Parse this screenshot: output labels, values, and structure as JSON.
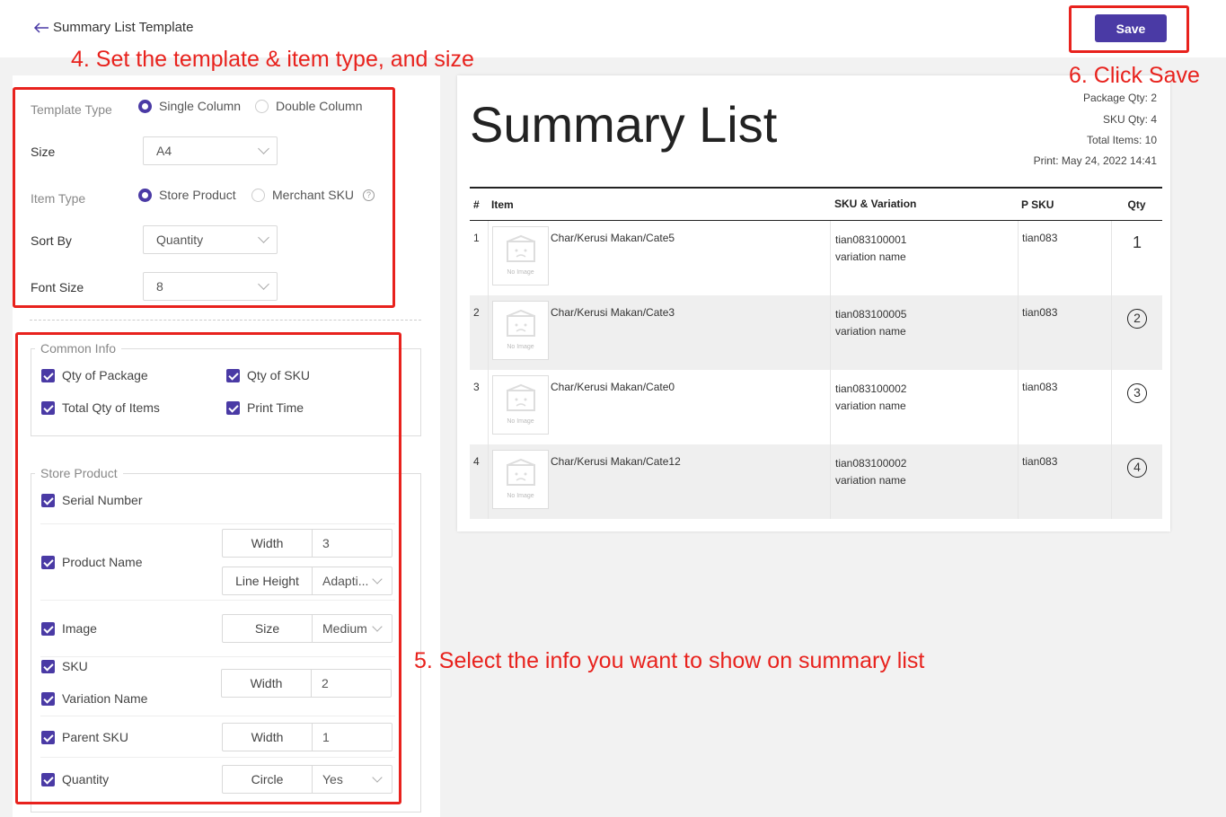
{
  "header": {
    "title": "Summary List Template",
    "save_label": "Save"
  },
  "settings": {
    "template_type_label": "Template Type",
    "template_options": [
      "Single Column",
      "Double Column"
    ],
    "size_label": "Size",
    "size_value": "A4",
    "item_type_label": "Item Type",
    "item_type_options": [
      "Store Product",
      "Merchant SKU"
    ],
    "sort_by_label": "Sort By",
    "sort_by_value": "Quantity",
    "font_size_label": "Font Size",
    "font_size_value": "8"
  },
  "common_info": {
    "legend": "Common Info",
    "items": [
      "Qty of Package",
      "Qty of SKU",
      "Total Qty of Items",
      "Print Time"
    ]
  },
  "store_product": {
    "legend": "Store Product",
    "serial_number": "Serial Number",
    "product_name": "Product Name",
    "product_name_width_label": "Width",
    "product_name_width_value": "3",
    "line_height_label": "Line Height",
    "line_height_value": "Adapti...",
    "image": "Image",
    "image_size_label": "Size",
    "image_size_value": "Medium",
    "sku": "SKU",
    "variation_name": "Variation Name",
    "sku_width_label": "Width",
    "sku_width_value": "2",
    "parent_sku": "Parent SKU",
    "parent_sku_width_label": "Width",
    "parent_sku_width_value": "1",
    "quantity": "Quantity",
    "circle_label": "Circle",
    "circle_value": "Yes"
  },
  "preview": {
    "title": "Summary List",
    "package_qty": "Package Qty: 2",
    "sku_qty": "SKU Qty: 4",
    "total_items": "Total Items: 10",
    "print_time": "Print: May 24, 2022 14:41",
    "columns": [
      "#",
      "Item",
      "SKU & Variation",
      "P SKU",
      "Qty"
    ],
    "no_image_label": "No Image",
    "rows": [
      {
        "no": "1",
        "name": "Char/Kerusi Makan/Cate5",
        "sku": "tian083100001",
        "variation": "variation name",
        "psku": "tian083",
        "qty": "1"
      },
      {
        "no": "2",
        "name": "Char/Kerusi Makan/Cate3",
        "sku": "tian083100005",
        "variation": "variation name",
        "psku": "tian083",
        "qty": "2"
      },
      {
        "no": "3",
        "name": "Char/Kerusi Makan/Cate0",
        "sku": "tian083100002",
        "variation": "variation name",
        "psku": "tian083",
        "qty": "3"
      },
      {
        "no": "4",
        "name": "Char/Kerusi Makan/Cate12",
        "sku": "tian083100002",
        "variation": "variation name",
        "psku": "tian083",
        "qty": "4"
      }
    ]
  },
  "annotations": {
    "step4": "4. Set the template & item type, and size",
    "step5": "5. Select the info you want to show on summary list",
    "step6": "6. Click Save"
  },
  "colors": {
    "accent": "#4a3aa5",
    "annotation": "#e8221d"
  },
  "icons": [
    "back-arrow-icon",
    "chevron-down-icon",
    "help-icon",
    "checkbox-checked-icon",
    "no-image-icon"
  ]
}
